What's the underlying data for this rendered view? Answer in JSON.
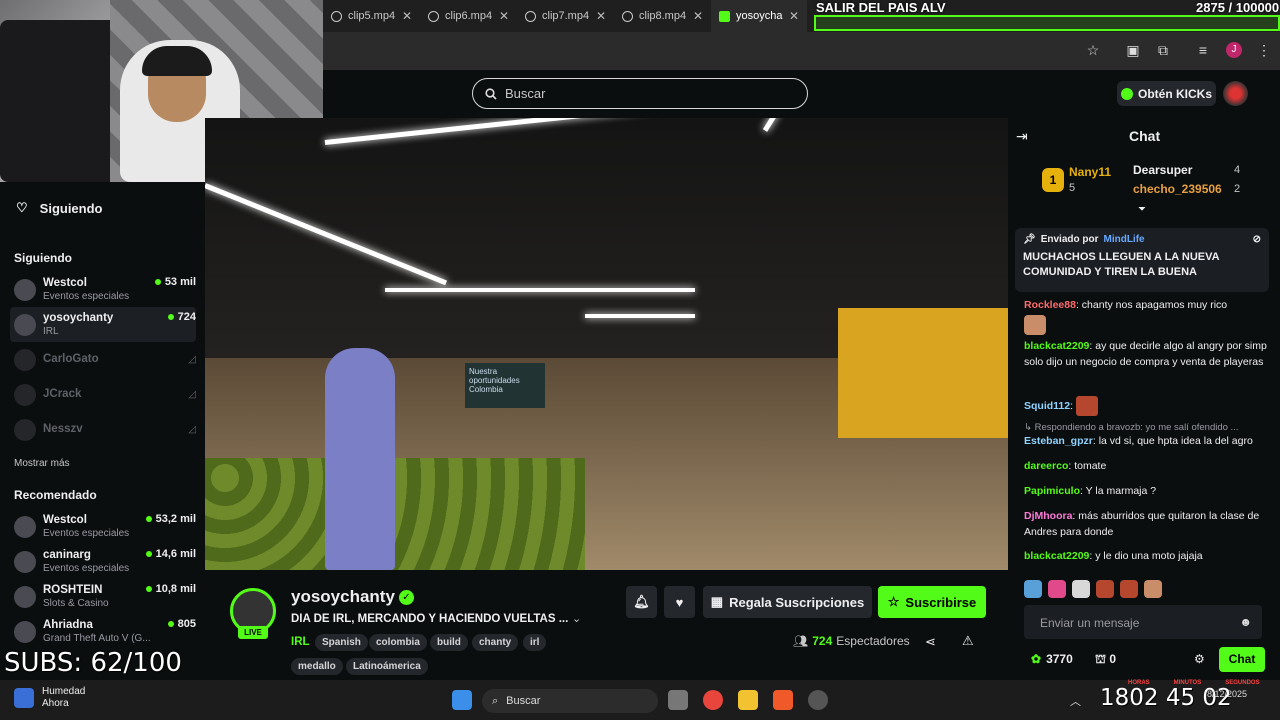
{
  "overlay": {
    "stream_title": "SALIR DEL PAIS ALV",
    "goal_counter": "2875 / 100000",
    "subs_counter": "SUBS: 62/100"
  },
  "browser": {
    "tabs": [
      {
        "label": "clip5.mp4"
      },
      {
        "label": "clip6.mp4"
      },
      {
        "label": "clip7.mp4"
      },
      {
        "label": "clip8.mp4"
      },
      {
        "label": "yosoycha",
        "active": true
      }
    ]
  },
  "header": {
    "search_placeholder": "Buscar",
    "get_kicks": "Obtén KICKs"
  },
  "sidebar": {
    "following_title": "Siguiendo",
    "following_section": "Siguiendo",
    "following": [
      {
        "name": "Westcol",
        "category": "Eventos especiales",
        "viewers": "53 mil",
        "live": true
      },
      {
        "name": "yosoychanty",
        "category": "IRL",
        "viewers": "724",
        "live": true,
        "selected": true
      },
      {
        "name": "CarloGato",
        "live": false
      },
      {
        "name": "JCrack",
        "live": false
      },
      {
        "name": "Nesszv",
        "live": false
      }
    ],
    "show_more": "Mostrar más",
    "recommended_section": "Recomendado",
    "recommended": [
      {
        "name": "Westcol",
        "category": "Eventos especiales",
        "viewers": "53,2 mil"
      },
      {
        "name": "caninarg",
        "category": "Eventos especiales",
        "viewers": "14,6 mil"
      },
      {
        "name": "ROSHTEIN",
        "category": "Slots & Casino",
        "viewers": "10,8 mil"
      },
      {
        "name": "Ahriadna",
        "category": "Grand Theft Auto V (G...",
        "viewers": "805"
      }
    ]
  },
  "stream": {
    "channel": "yosoychanty",
    "live_badge": "LIVE",
    "title": "DIA DE IRL, MERCANDO Y HACIENDO VUELTAS ...",
    "category": "IRL",
    "tags": [
      "Spanish",
      "colombia",
      "build",
      "chanty",
      "irl",
      "medallo",
      "Latinoámerica"
    ],
    "gift_subs": "Regala Suscripciones",
    "subscribe": "Suscribirse",
    "viewers_count": "724",
    "viewers_label": "Espectadores"
  },
  "chat": {
    "title": "Chat",
    "leaders": {
      "first": {
        "name": "Nany11",
        "count": "5"
      },
      "second": {
        "name": "Dearsuper",
        "count": "4"
      },
      "third": {
        "name": "checho_239506",
        "count": "2"
      }
    },
    "pinned": {
      "sent_by_label": "Enviado por",
      "sender": "MindLife",
      "text": "MUCHACHOS LLEGUEN A LA NUEVA COMUNIDAD Y TIREN LA BUENA"
    },
    "messages": [
      {
        "user": "Rocklee88",
        "text": "chanty nos apagamos muy rico",
        "color": "#ff6b6b"
      },
      {
        "user": "blackcat2209",
        "text": "ay que decirle algo al angry por simp solo dijo un negocio de compra y venta de playeras",
        "color": "#53fc18"
      },
      {
        "user": "Squid112",
        "text": "",
        "color": "#8fd3ff"
      },
      {
        "reply": "Respondiendo a bravozb: yo me salí ofendido ..."
      },
      {
        "user": "Esteban_gpzr",
        "text": "la vd si, que hpta idea la del agro",
        "color": "#8fd3ff"
      },
      {
        "user": "dareerco",
        "text": "tomate",
        "color": "#53fc18"
      },
      {
        "user": "Papimiculo",
        "text": "Y la marmaja ?",
        "color": "#53fc18"
      },
      {
        "user": "DjMhoora",
        "text": "más aburridos que quitaron la clase de Andres para donde",
        "color": "#ff7ad9"
      },
      {
        "user": "blackcat2209",
        "text": "y le dio una moto jajaja",
        "color": "#53fc18"
      }
    ],
    "input_placeholder": "Enviar un mensaje",
    "kicks_balance": "3770",
    "points_balance": "0",
    "send_label": "Chat"
  },
  "taskbar": {
    "weather_label": "Humedad",
    "weather_sub": "Ahora",
    "search_label": "Buscar",
    "clock": "1802 45 02",
    "clock_labels": [
      "HORAS",
      "MINUTOS",
      "SEGUNDOS"
    ],
    "date": "8/12/2025"
  },
  "colors": {
    "accent": "#53fc18",
    "background": "#0b0e0f"
  }
}
